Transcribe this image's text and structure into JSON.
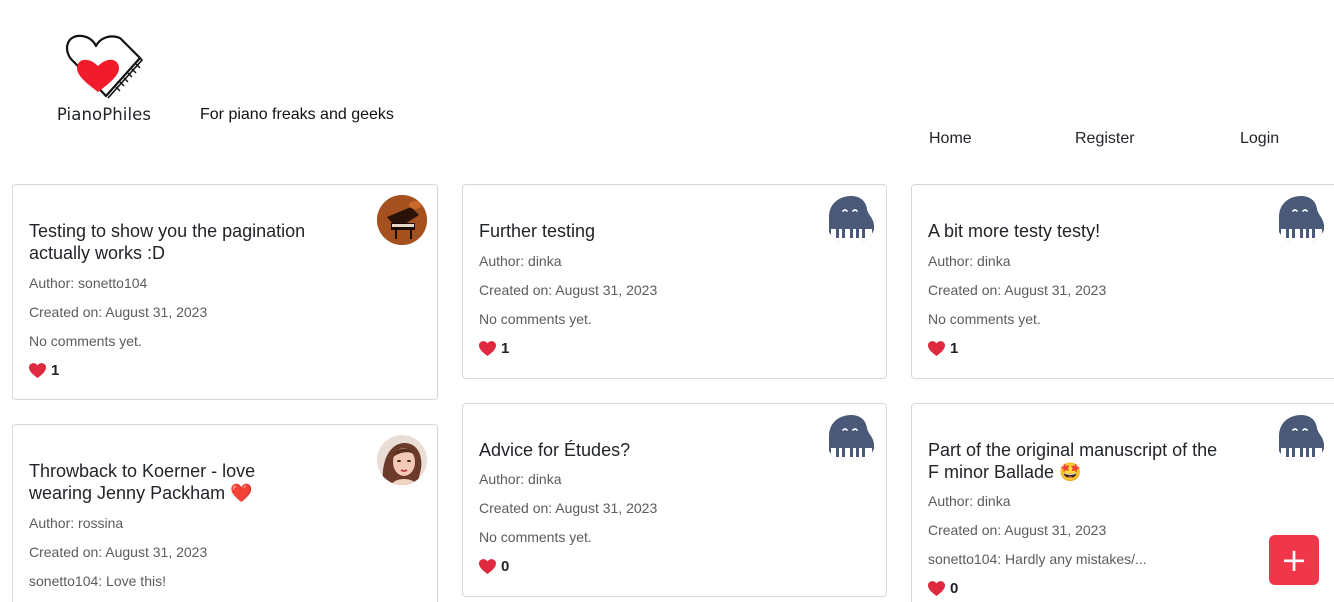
{
  "header": {
    "brand": "PianoPhiles",
    "tagline": "For piano freaks and geeks"
  },
  "nav": {
    "home": "Home",
    "register": "Register",
    "login": "Login"
  },
  "colors": {
    "heart": "#e0283e",
    "fab": "#f0374a",
    "avatar_default": "#4a5978"
  },
  "posts": [
    {
      "title": "Testing to show you the pagination actually works :D",
      "author": "Author: sonetto104",
      "created": "Created on: August 31, 2023",
      "comments": "No comments yet.",
      "likes": "1",
      "avatar": "grand-piano-photo"
    },
    {
      "title": "Further testing",
      "author": "Author: dinka",
      "created": "Created on: August 31, 2023",
      "comments": "No comments yet.",
      "likes": "1",
      "avatar": "default-piano-avatar"
    },
    {
      "title": "A bit more testy testy!",
      "author": "Author: dinka",
      "created": "Created on: August 31, 2023",
      "comments": "No comments yet.",
      "likes": "1",
      "avatar": "default-piano-avatar"
    },
    {
      "title": "Throwback to Koerner - love wearing Jenny Packham ❤️",
      "author": "Author: rossina",
      "created": "Created on: August 31, 2023",
      "comments": "sonetto104: Love this!",
      "avatar": "woman-portrait-photo"
    },
    {
      "title": "Advice for Études?",
      "author": "Author: dinka",
      "created": "Created on: August 31, 2023",
      "comments": "No comments yet.",
      "likes": "0",
      "avatar": "default-piano-avatar"
    },
    {
      "title": "Part of the original manuscript of the F minor Ballade 🤩",
      "author": "Author: dinka",
      "created": "Created on: August 31, 2023",
      "comments": "sonetto104: Hardly any mistakes/...",
      "likes": "0",
      "avatar": "default-piano-avatar"
    }
  ],
  "fab": {
    "label": "+"
  }
}
